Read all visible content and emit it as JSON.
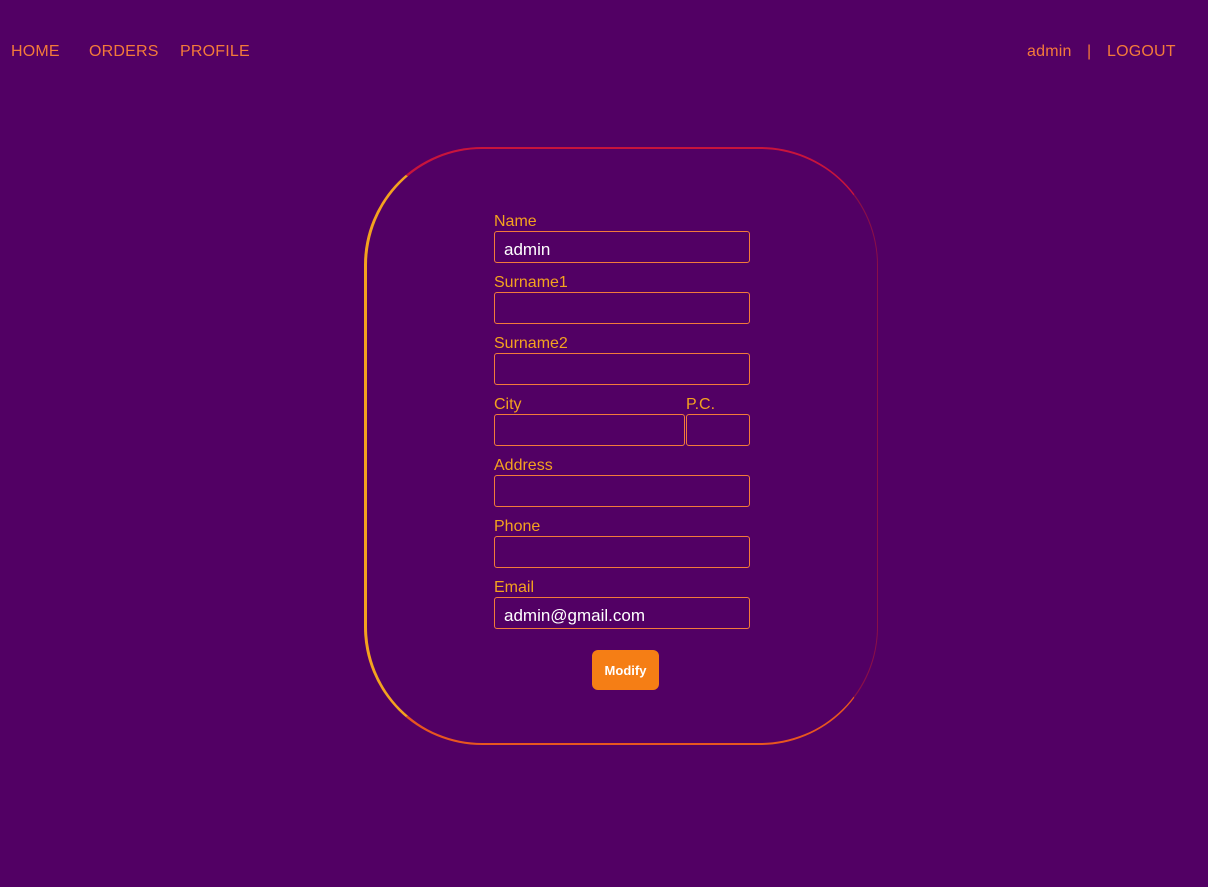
{
  "nav": {
    "home": "HOME",
    "orders": "ORDERS",
    "profile": "PROFILE",
    "user": "admin",
    "separator": "|",
    "logout": "LOGOUT"
  },
  "form": {
    "name": {
      "label": "Name",
      "value": "admin"
    },
    "surname1": {
      "label": "Surname1",
      "value": ""
    },
    "surname2": {
      "label": "Surname2",
      "value": ""
    },
    "city": {
      "label": "City",
      "value": ""
    },
    "pc": {
      "label": "P.C.",
      "value": ""
    },
    "address": {
      "label": "Address",
      "value": ""
    },
    "phone": {
      "label": "Phone",
      "value": ""
    },
    "email": {
      "label": "Email",
      "value": "admin@gmail.com"
    },
    "submit_label": "Modify"
  },
  "colors": {
    "background": "#520064",
    "accent": "#f47a3a",
    "label": "#f4a21f",
    "button": "#f57e15"
  }
}
